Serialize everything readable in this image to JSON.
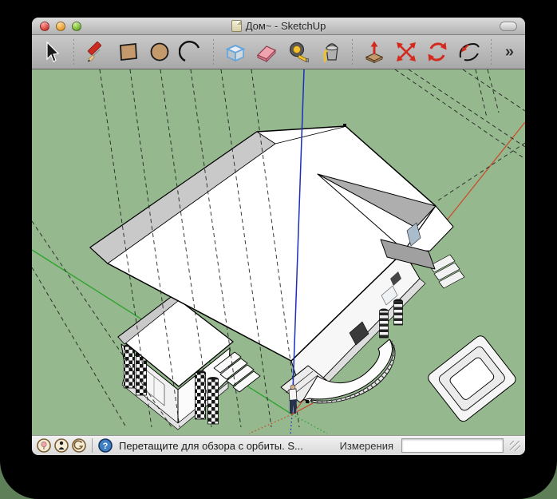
{
  "window": {
    "title": "Дом~ - SketchUp",
    "traffic_lights": {
      "close": "close",
      "minimize": "minimize",
      "zoom": "zoom"
    },
    "toolbar_toggle": "toolbar-toggle"
  },
  "toolbar": {
    "overflow_label": "»",
    "tools": [
      {
        "name": "select",
        "icon": "cursor-arrow-icon"
      },
      {
        "name": "line",
        "icon": "pencil-icon"
      },
      {
        "name": "rectangle",
        "icon": "rectangle-icon"
      },
      {
        "name": "circle",
        "icon": "circle-icon"
      },
      {
        "name": "arc",
        "icon": "arc-icon"
      },
      {
        "name": "make-component",
        "icon": "blue-box-icon"
      },
      {
        "name": "eraser",
        "icon": "eraser-icon"
      },
      {
        "name": "tape-measure",
        "icon": "tape-measure-icon"
      },
      {
        "name": "paint-bucket",
        "icon": "paint-bucket-icon"
      },
      {
        "name": "push-pull",
        "icon": "box-up-arrow-icon"
      },
      {
        "name": "move",
        "icon": "four-arrows-icon"
      },
      {
        "name": "rotate",
        "icon": "circular-arrows-icon"
      },
      {
        "name": "orbit",
        "icon": "orbit-arrows-icon"
      }
    ]
  },
  "viewport": {
    "colors": {
      "background": "#96B88F",
      "axis_red": "#C8502D",
      "axis_green": "#2FA32F",
      "axis_blue": "#1B2FBB",
      "roof_white": "#FFFFFF",
      "roof_gray": "#C9C9C9"
    }
  },
  "statusbar": {
    "icons": [
      {
        "name": "status-balloon"
      },
      {
        "name": "status-person"
      },
      {
        "name": "status-google"
      },
      {
        "name": "help"
      }
    ],
    "hint": "Перетащите для обзора с орбиты.  S...",
    "measurements_label": "Измерения",
    "measurements_value": "",
    "measurements_placeholder": ""
  }
}
